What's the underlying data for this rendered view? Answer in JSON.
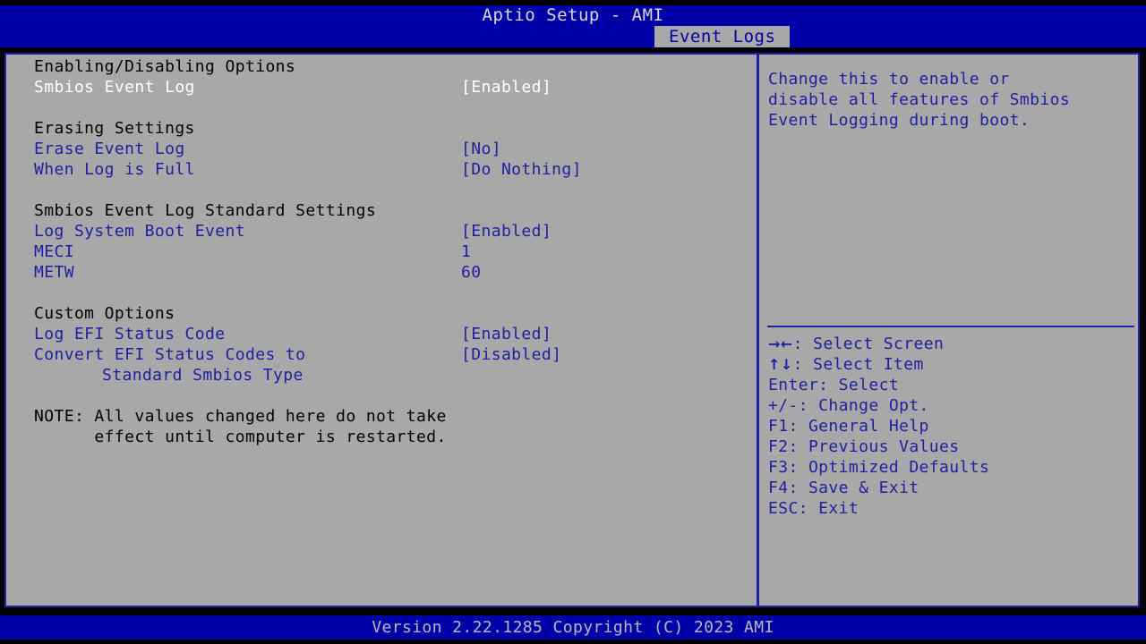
{
  "header": {
    "title": "Aptio Setup - AMI",
    "active_tab": "Event Logs",
    "bg_color": "#0000a8",
    "tab_bg_color": "#a8a8a8",
    "tab_text_color": "#0000a8"
  },
  "colors": {
    "panel_bg": "#a8a8a8",
    "border": "#2020a0",
    "item_text": "#2020a0",
    "section_header_text": "#000000",
    "selected_text": "#ffffff",
    "footer_text": "#b8b8b8"
  },
  "settings": {
    "rows": [
      {
        "kind": "section",
        "label": "Enabling/Disabling Options",
        "value": ""
      },
      {
        "kind": "selected",
        "label": "Smbios Event Log",
        "value": "[Enabled]"
      },
      {
        "kind": "spacer",
        "label": "",
        "value": ""
      },
      {
        "kind": "section",
        "label": "Erasing Settings",
        "value": ""
      },
      {
        "kind": "item",
        "label": "Erase Event Log",
        "value": "[No]"
      },
      {
        "kind": "item",
        "label": "When Log is Full",
        "value": "[Do Nothing]"
      },
      {
        "kind": "spacer",
        "label": "",
        "value": ""
      },
      {
        "kind": "section",
        "label": "Smbios Event Log Standard Settings",
        "value": ""
      },
      {
        "kind": "item",
        "label": "Log System Boot Event",
        "value": "[Enabled]"
      },
      {
        "kind": "item",
        "label": "MECI",
        "value": "1"
      },
      {
        "kind": "item",
        "label": "METW",
        "value": "60"
      },
      {
        "kind": "spacer",
        "label": "",
        "value": ""
      },
      {
        "kind": "section",
        "label": "Custom Options",
        "value": ""
      },
      {
        "kind": "item",
        "label": "Log EFI Status Code",
        "value": "[Enabled]"
      },
      {
        "kind": "item",
        "label": "Convert EFI Status Codes to",
        "value": "[Disabled]"
      },
      {
        "kind": "item-cont",
        "label": "Standard Smbios Type",
        "value": ""
      }
    ],
    "note_lines": [
      "NOTE: All values changed here do not take",
      "      effect until computer is restarted."
    ]
  },
  "help": {
    "lines": [
      "Change this to enable or",
      "disable all features of Smbios",
      "Event Logging during boot."
    ]
  },
  "key_legend": {
    "items": [
      {
        "glyph": "→←",
        "text": ": Select Screen"
      },
      {
        "glyph": "↑↓",
        "text": ": Select Item"
      },
      {
        "glyph": "",
        "text": "Enter: Select"
      },
      {
        "glyph": "",
        "text": "+/-: Change Opt."
      },
      {
        "glyph": "",
        "text": "F1: General Help"
      },
      {
        "glyph": "",
        "text": "F2: Previous Values"
      },
      {
        "glyph": "",
        "text": "F3: Optimized Defaults"
      },
      {
        "glyph": "",
        "text": "F4: Save & Exit"
      },
      {
        "glyph": "",
        "text": "ESC: Exit"
      }
    ]
  },
  "footer": {
    "version_text": "Version 2.22.1285 Copyright (C) 2023 AMI"
  }
}
